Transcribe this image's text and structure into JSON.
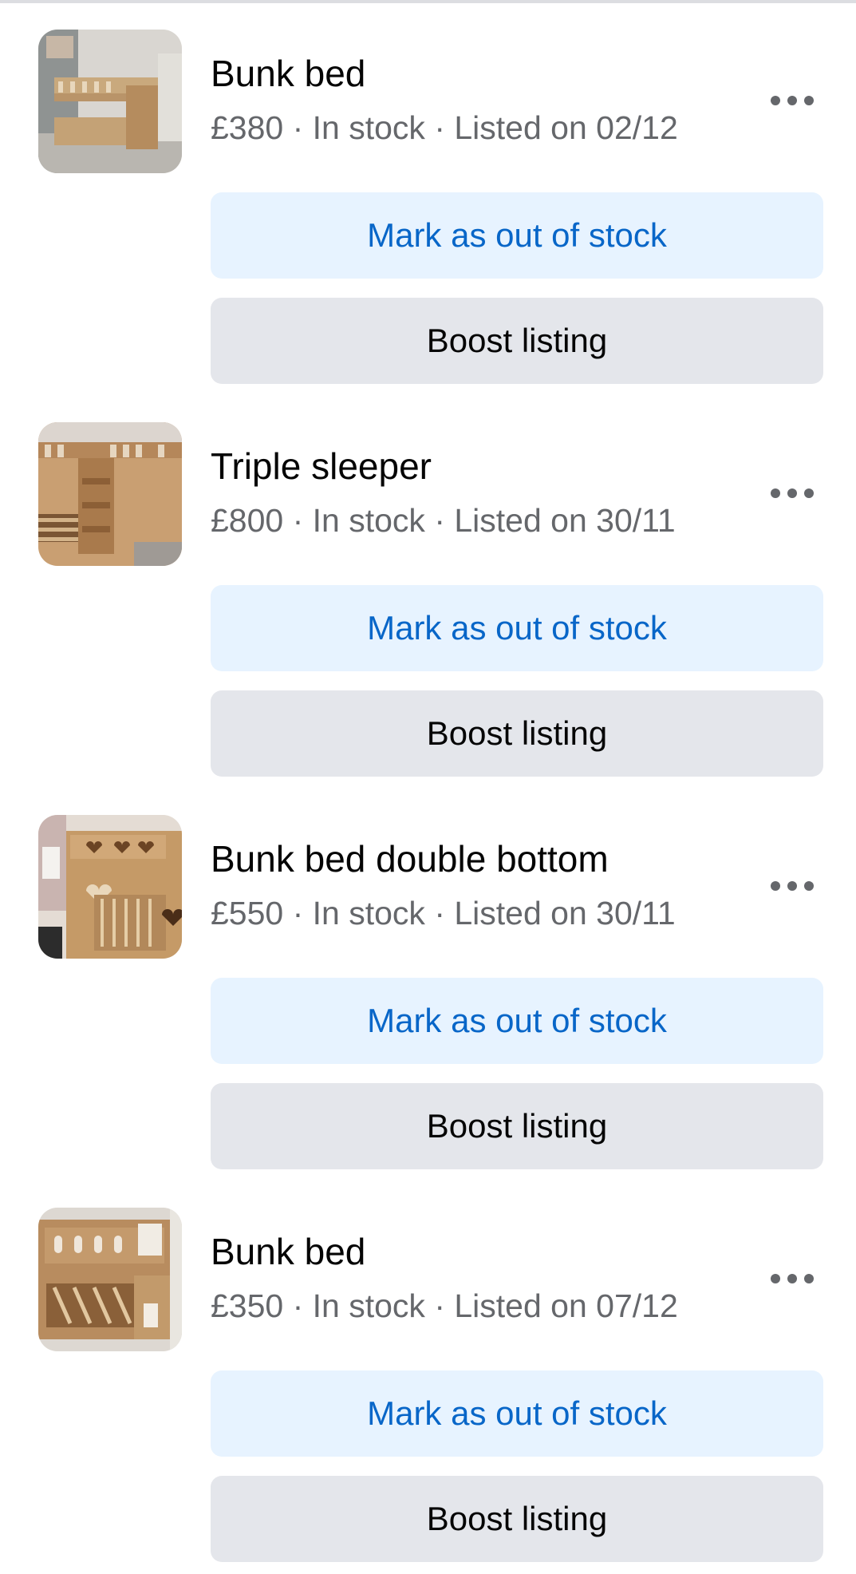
{
  "listings": [
    {
      "title": "Bunk bed",
      "meta": "£380 · In stock · Listed on 02/12",
      "mark_label": "Mark as out of stock",
      "boost_label": "Boost listing"
    },
    {
      "title": "Triple sleeper",
      "meta": "£800 · In stock · Listed on 30/11",
      "mark_label": "Mark as out of stock",
      "boost_label": "Boost listing"
    },
    {
      "title": "Bunk bed double bottom",
      "meta": "£550 · In stock · Listed on 30/11",
      "mark_label": "Mark as out of stock",
      "boost_label": "Boost listing"
    },
    {
      "title": "Bunk bed",
      "meta": "£350 · In stock · Listed on 07/12",
      "mark_label": "Mark as out of stock",
      "boost_label": "Boost listing"
    }
  ],
  "icons": {
    "more": "more-horizontal-icon"
  },
  "colors": {
    "primary_button_bg": "#e7f3ff",
    "primary_button_text": "#0866c8",
    "secondary_button_bg": "#e4e6eb",
    "meta_text": "#65676b"
  }
}
